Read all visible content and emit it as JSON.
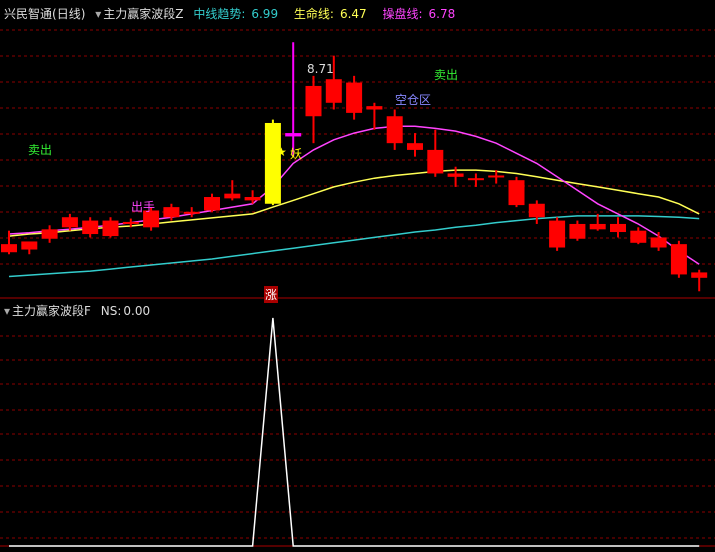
{
  "header": {
    "stock_name": "兴民智通",
    "period": "(日线)",
    "indicator": "主力赢家波段Z",
    "lines": [
      {
        "label": "中线趋势:",
        "value": "6.99",
        "color": "#33cccc"
      },
      {
        "label": "生命线:",
        "value": "6.47",
        "color": "#ffff55"
      },
      {
        "label": "操盘线:",
        "value": "6.78",
        "color": "#ff44ff"
      }
    ]
  },
  "annotations": {
    "high_price": "8.71",
    "sell_left": "卖出",
    "sell_right": "卖出",
    "exit": "出手",
    "empty_zone": "空仓区",
    "demon": "妖",
    "star": "★",
    "rise": "涨"
  },
  "sub_header": {
    "indicator": "主力赢家波段F",
    "ns_label": "NS:",
    "ns_value": "0.00"
  },
  "colors": {
    "up": "#ff0000",
    "down": "#ff0000",
    "trend": "#33cccc",
    "life": "#ffff55",
    "operate": "#ff44ff",
    "highlight_yellow": "#ffff00",
    "highlight_magenta": "#ff00ff",
    "grid": "#8b0000"
  },
  "chart_data": {
    "type": "candlestick",
    "candles": [
      {
        "o": 5.7,
        "h": 5.9,
        "l": 5.55,
        "c": 5.58
      },
      {
        "o": 5.62,
        "h": 5.72,
        "l": 5.55,
        "c": 5.74
      },
      {
        "o": 5.78,
        "h": 5.98,
        "l": 5.72,
        "c": 5.92
      },
      {
        "o": 5.95,
        "h": 6.15,
        "l": 5.9,
        "c": 6.1
      },
      {
        "o": 5.85,
        "h": 6.1,
        "l": 5.8,
        "c": 6.05
      },
      {
        "o": 5.82,
        "h": 6.1,
        "l": 5.8,
        "c": 6.05
      },
      {
        "o": 6.0,
        "h": 6.08,
        "l": 5.95,
        "c": 6.03
      },
      {
        "o": 5.95,
        "h": 6.25,
        "l": 5.9,
        "c": 6.2
      },
      {
        "o": 6.1,
        "h": 6.3,
        "l": 6.05,
        "c": 6.25
      },
      {
        "o": 6.15,
        "h": 6.25,
        "l": 6.1,
        "c": 6.18
      },
      {
        "o": 6.2,
        "h": 6.45,
        "l": 6.18,
        "c": 6.4
      },
      {
        "o": 6.38,
        "h": 6.65,
        "l": 6.35,
        "c": 6.45
      },
      {
        "o": 6.35,
        "h": 6.5,
        "l": 6.3,
        "c": 6.4
      },
      {
        "o": 6.3,
        "h": 7.55,
        "l": 6.28,
        "c": 7.5
      },
      {
        "o": 7.3,
        "h": 8.7,
        "l": 7.0,
        "c": 7.35
      },
      {
        "o": 7.6,
        "h": 8.2,
        "l": 7.2,
        "c": 8.05
      },
      {
        "o": 8.15,
        "h": 8.5,
        "l": 7.7,
        "c": 7.8
      },
      {
        "o": 8.1,
        "h": 8.2,
        "l": 7.55,
        "c": 7.65
      },
      {
        "o": 7.75,
        "h": 7.8,
        "l": 7.4,
        "c": 7.7
      },
      {
        "o": 7.6,
        "h": 7.7,
        "l": 7.1,
        "c": 7.2
      },
      {
        "o": 7.2,
        "h": 7.35,
        "l": 7.0,
        "c": 7.1
      },
      {
        "o": 7.1,
        "h": 7.4,
        "l": 6.7,
        "c": 6.75
      },
      {
        "o": 6.75,
        "h": 6.85,
        "l": 6.55,
        "c": 6.7
      },
      {
        "o": 6.65,
        "h": 6.75,
        "l": 6.55,
        "c": 6.68
      },
      {
        "o": 6.7,
        "h": 6.8,
        "l": 6.6,
        "c": 6.72
      },
      {
        "o": 6.65,
        "h": 6.7,
        "l": 6.25,
        "c": 6.28
      },
      {
        "o": 6.3,
        "h": 6.35,
        "l": 6.0,
        "c": 6.1
      },
      {
        "o": 6.05,
        "h": 6.1,
        "l": 5.6,
        "c": 5.65
      },
      {
        "o": 6.0,
        "h": 6.05,
        "l": 5.75,
        "c": 5.78
      },
      {
        "o": 6.0,
        "h": 6.15,
        "l": 5.9,
        "c": 5.92
      },
      {
        "o": 6.0,
        "h": 6.1,
        "l": 5.8,
        "c": 5.88
      },
      {
        "o": 5.9,
        "h": 5.95,
        "l": 5.7,
        "c": 5.72
      },
      {
        "o": 5.8,
        "h": 5.88,
        "l": 5.6,
        "c": 5.65
      },
      {
        "o": 5.7,
        "h": 5.75,
        "l": 5.2,
        "c": 5.25
      },
      {
        "o": 5.28,
        "h": 5.32,
        "l": 5.0,
        "c": 5.2
      }
    ],
    "trend_line": [
      5.22,
      5.24,
      5.26,
      5.28,
      5.3,
      5.33,
      5.36,
      5.39,
      5.42,
      5.45,
      5.48,
      5.52,
      5.56,
      5.6,
      5.64,
      5.68,
      5.72,
      5.76,
      5.8,
      5.84,
      5.88,
      5.91,
      5.95,
      5.98,
      6.02,
      6.05,
      6.08,
      6.1,
      6.12,
      6.12,
      6.12,
      6.12,
      6.11,
      6.1,
      6.08
    ],
    "life_line": [
      5.82,
      5.85,
      5.87,
      5.9,
      5.93,
      5.95,
      5.97,
      6.0,
      6.03,
      6.06,
      6.09,
      6.12,
      6.15,
      6.25,
      6.35,
      6.45,
      6.55,
      6.62,
      6.68,
      6.72,
      6.75,
      6.78,
      6.8,
      6.8,
      6.78,
      6.75,
      6.7,
      6.65,
      6.6,
      6.55,
      6.5,
      6.45,
      6.4,
      6.3,
      6.15
    ],
    "operate_line": [
      5.85,
      5.87,
      5.9,
      5.92,
      5.95,
      5.98,
      6.02,
      6.06,
      6.1,
      6.15,
      6.2,
      6.25,
      6.3,
      6.55,
      6.9,
      7.1,
      7.25,
      7.35,
      7.42,
      7.45,
      7.45,
      7.42,
      7.38,
      7.3,
      7.2,
      7.05,
      6.9,
      6.7,
      6.5,
      6.3,
      6.15,
      6.0,
      5.82,
      5.6,
      5.4
    ],
    "price_range": [
      4.9,
      9.0
    ],
    "sub_series": {
      "name": "NS",
      "values": [
        0,
        0,
        0,
        0,
        0,
        0,
        0,
        0,
        0,
        0,
        0,
        0,
        0,
        100,
        0,
        0,
        0,
        0,
        0,
        0,
        0,
        0,
        0,
        0,
        0,
        0,
        0,
        0,
        0,
        0,
        0,
        0,
        0,
        0,
        0
      ],
      "range": [
        0,
        100
      ]
    }
  }
}
